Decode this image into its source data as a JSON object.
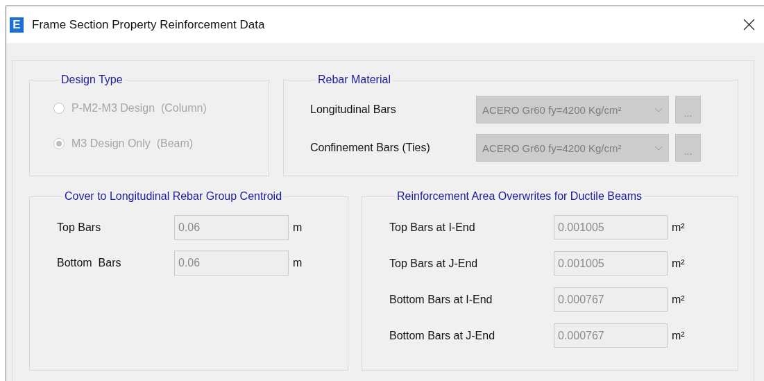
{
  "window": {
    "app_icon": "E",
    "title": "Frame Section Property Reinforcement Data"
  },
  "design_type": {
    "title": "Design Type",
    "options": [
      {
        "label": "P-M2-M3 Design  (Column)",
        "selected": false,
        "disabled": true
      },
      {
        "label": "M3 Design Only  (Beam)",
        "selected": true,
        "disabled": true
      }
    ]
  },
  "rebar_material": {
    "title": "Rebar Material",
    "rows": [
      {
        "label": "Longitudinal Bars",
        "value": "ACERO Gr60 fy=4200 Kg/cm²",
        "disabled": true,
        "button": "..."
      },
      {
        "label": "Confinement Bars (Ties)",
        "value": "ACERO Gr60 fy=4200 Kg/cm²",
        "disabled": true,
        "button": "..."
      }
    ]
  },
  "cover": {
    "title": "Cover to Longitudinal Rebar Group Centroid",
    "rows": [
      {
        "label": "Top Bars",
        "value": "0.06",
        "unit": "m",
        "disabled": true
      },
      {
        "label": "Bottom  Bars",
        "value": "0.06",
        "unit": "m",
        "disabled": true
      }
    ]
  },
  "area_overwrites": {
    "title": "Reinforcement Area Overwrites for Ductile Beams",
    "rows": [
      {
        "label": "Top Bars at I-End",
        "value": "0.001005",
        "unit": "m²",
        "disabled": true
      },
      {
        "label": "Top Bars at J-End",
        "value": "0.001005",
        "unit": "m²",
        "disabled": true
      },
      {
        "label": "Bottom Bars at I-End",
        "value": "0.000767",
        "unit": "m²",
        "disabled": true
      },
      {
        "label": "Bottom Bars at J-End",
        "value": "0.000767",
        "unit": "m²",
        "disabled": true
      }
    ]
  }
}
